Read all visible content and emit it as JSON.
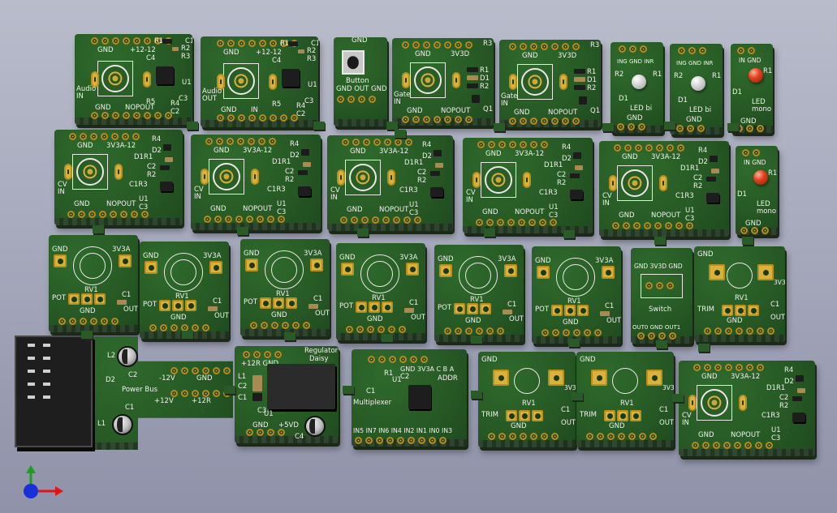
{
  "boards": [
    {
      "name": "audio-in",
      "labels": {
        "top": "GND",
        "top2": "+12-12",
        "left": "Audio\nIN",
        "bottom": "GND",
        "bottom2": "NOPOUT",
        "r1": "R1",
        "c1": "C1",
        "c4": "C4",
        "r2": "R2",
        "r3": "R3",
        "u1": "U1",
        "c3": "C3",
        "r5": "R5",
        "r4": "R4",
        "c2": "C2"
      }
    },
    {
      "name": "audio-out",
      "labels": {
        "top": "GND",
        "top2": "+12-12",
        "left": "Audio\nOUT",
        "bottom": "GND",
        "bottom2": "IN",
        "r1": "R1",
        "c1": "C1",
        "c4": "C4",
        "r2": "R2",
        "r3": "R3",
        "u1": "U1",
        "c3": "C3",
        "r5": "R5",
        "r4": "R4",
        "c2": "C2"
      }
    },
    {
      "name": "button",
      "labels": {
        "title": "Button",
        "bottom": "GND OUT GND",
        "top": "GND"
      }
    },
    {
      "name": "gate-in-1",
      "labels": {
        "top": "GND",
        "top2": "3V3D",
        "left": "Gate\nIN",
        "bottom": "GND",
        "bottom2": "NOPOUT",
        "r3": "R3",
        "r1": "R1",
        "d1": "D1",
        "r2": "R2",
        "q1": "Q1"
      }
    },
    {
      "name": "gate-in-2",
      "labels": {
        "top": "GND",
        "top2": "3V3D",
        "left": "Gate\nIN",
        "bottom": "GND",
        "bottom2": "NOPOUT",
        "r3": "R3",
        "r1": "R1",
        "d1": "D1",
        "r2": "R2",
        "q1": "Q1"
      }
    },
    {
      "name": "led-bi-1",
      "labels": {
        "top": "ING GND INR",
        "r2": "R2",
        "r1": "R1",
        "d1": "D1",
        "title": "LED bi",
        "bottom": "GND"
      }
    },
    {
      "name": "led-bi-2",
      "labels": {
        "top": "ING GND INR",
        "r2": "R2",
        "r1": "R1",
        "d1": "D1",
        "title": "LED bi",
        "bottom": "GND"
      }
    },
    {
      "name": "led-mono-1",
      "labels": {
        "top": "IN GND",
        "r1": "R1",
        "d1": "D1",
        "title": "LED\nmono",
        "bottom": "GND"
      }
    },
    {
      "name": "led-mono-2",
      "labels": {
        "top": "IN GND",
        "r1": "R1",
        "d1": "D1",
        "title": "LED\nmono",
        "bottom": "GND"
      }
    },
    {
      "name": "cv-in",
      "labels": {
        "top": "GND",
        "top2": "3V3A-12",
        "r4": "R4",
        "d2": "D2",
        "d1r1": "D1R1",
        "c2": "C2",
        "r2": "R2",
        "c1r3": "C1R3",
        "u1": "U1",
        "c3": "C3",
        "left": "CV\nIN",
        "bottom": "GND",
        "bottom2": "NOPOUT"
      }
    },
    {
      "name": "pot",
      "labels": {
        "gnd": "GND",
        "v": "3V3A",
        "rv1": "RV1",
        "pot": "POT",
        "c1": "C1",
        "out": "OUT",
        "bottom": "GND"
      }
    },
    {
      "name": "switch",
      "labels": {
        "top": "GND 3V3D GND",
        "title": "Switch",
        "bottom": "OUT0 GND OUT1"
      }
    },
    {
      "name": "trim",
      "labels": {
        "gnd": "GND",
        "v": "3V3A",
        "rv1": "RV1",
        "trim": "TRIM",
        "c1": "C1",
        "out": "OUT",
        "bottom": "GND"
      }
    },
    {
      "name": "power-bus",
      "labels": {
        "d2": "D2",
        "c2": "C2",
        "l2": "L2",
        "l1": "L1",
        "d1": "D1",
        "c1": "C1",
        "title": "Power Bus",
        "m12": "-12V",
        "gnd": "GND",
        "p12v": "+12V",
        "p12r": "+12R"
      }
    },
    {
      "name": "regulator",
      "labels": {
        "title": "Regulator",
        "sub": "Daisy",
        "top": "+12R GND",
        "l1": "L1",
        "c2": "C2",
        "c1": "C1",
        "c3": "C3",
        "u1": "U1",
        "c4": "C4",
        "bottom": "GND",
        "bottom2": "+5VD"
      }
    },
    {
      "name": "multiplexer",
      "labels": {
        "top": "GND 3V3A C B A",
        "r1": "R1",
        "u1": "U1",
        "c2": "C2",
        "addr": "ADDR",
        "c1": "C1",
        "title": "Multiplexer",
        "bottom": "IN5 IN7 IN6 IN4 IN2 IN1 IN0 IN3"
      }
    }
  ],
  "colors": {
    "board": "#275a25",
    "silk": "#f1f1ec",
    "pad": "#d9b13b",
    "background": "#a7aabd"
  },
  "axes": {
    "x": "x-axis-arrow",
    "y": "y-axis-arrow",
    "z": "z-axis-arrow"
  }
}
